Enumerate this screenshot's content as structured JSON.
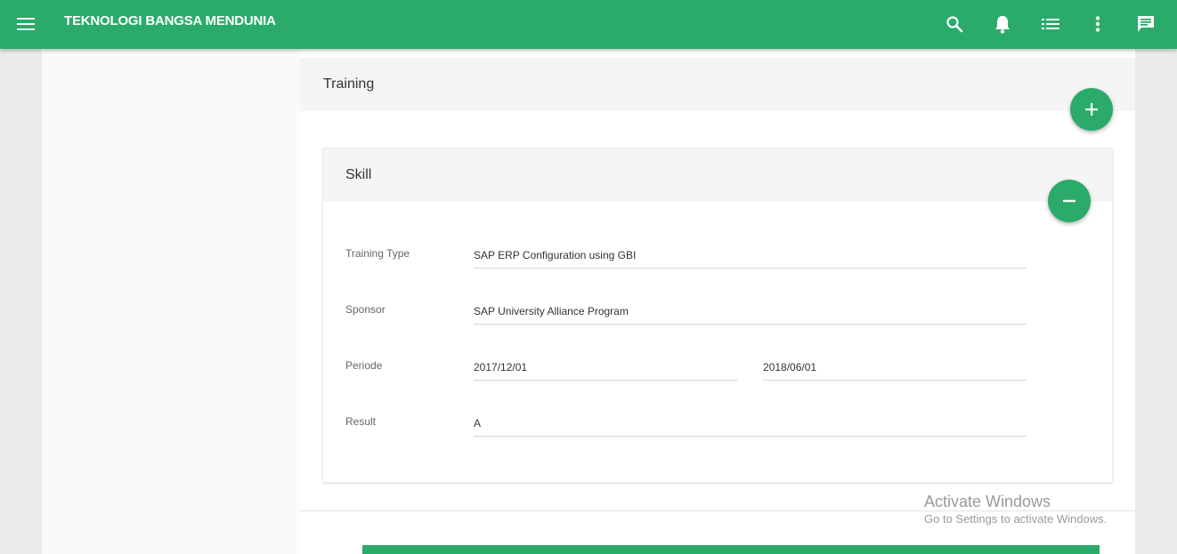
{
  "header": {
    "title": "TEKNOLOGI BANGSA MENDUNIA",
    "icons": [
      "menu-icon",
      "search-icon",
      "bell-icon",
      "list-icon",
      "more-vert-icon",
      "message-icon"
    ],
    "color": "#2aab6a"
  },
  "training": {
    "title": "Training",
    "add_icon": "plus-icon"
  },
  "skill": {
    "title": "Skill",
    "remove_icon": "minus-icon",
    "fields": {
      "training_type": {
        "label": "Training Type",
        "value": "SAP ERP Configuration using GBI"
      },
      "sponsor": {
        "label": "Sponsor",
        "value": "SAP University Alliance Program"
      },
      "periode": {
        "label": "Periode",
        "start": "2017/12/01",
        "end": "2018/06/01"
      },
      "result": {
        "label": "Result",
        "value": "A"
      }
    }
  },
  "watermark": {
    "title": "Activate Windows",
    "subtitle": "Go to Settings to activate Windows."
  }
}
